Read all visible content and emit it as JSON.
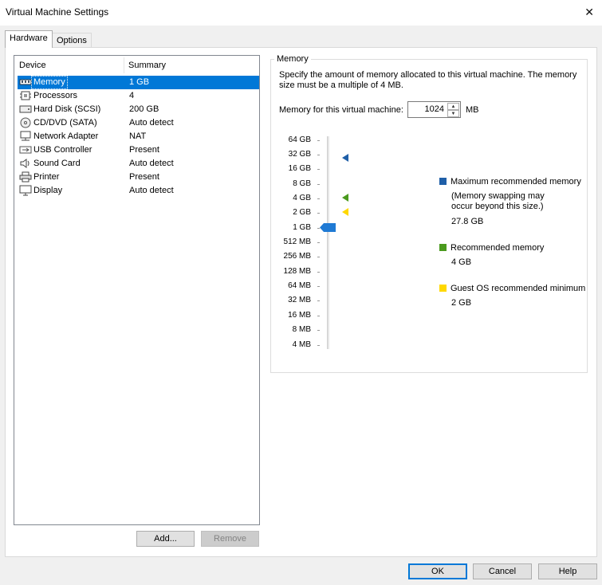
{
  "window": {
    "title": "Virtual Machine Settings",
    "close_glyph": "✕"
  },
  "tabs": [
    {
      "label": "Hardware"
    },
    {
      "label": "Options"
    }
  ],
  "device_list": {
    "headers": {
      "device": "Device",
      "summary": "Summary"
    },
    "rows": [
      {
        "device": "Memory",
        "summary": "1 GB",
        "icon": "memory-icon",
        "selected": true
      },
      {
        "device": "Processors",
        "summary": "4",
        "icon": "processor-icon"
      },
      {
        "device": "Hard Disk (SCSI)",
        "summary": "200 GB",
        "icon": "hard-disk-icon"
      },
      {
        "device": "CD/DVD (SATA)",
        "summary": "Auto detect",
        "icon": "cd-dvd-icon"
      },
      {
        "device": "Network Adapter",
        "summary": "NAT",
        "icon": "network-adapter-icon"
      },
      {
        "device": "USB Controller",
        "summary": "Present",
        "icon": "usb-icon"
      },
      {
        "device": "Sound Card",
        "summary": "Auto detect",
        "icon": "speaker-icon"
      },
      {
        "device": "Printer",
        "summary": "Present",
        "icon": "printer-icon"
      },
      {
        "device": "Display",
        "summary": "Auto detect",
        "icon": "monitor-icon"
      }
    ],
    "add_label": "Add...",
    "remove_label": "Remove"
  },
  "memory": {
    "group_title": "Memory",
    "description": "Specify the amount of memory allocated to this virtual machine. The memory size must be a multiple of 4 MB.",
    "field_label": "Memory for this virtual machine:",
    "value": "1024",
    "unit": "MB",
    "scale": [
      "64 GB",
      "32 GB",
      "16 GB",
      "8 GB",
      "4 GB",
      "2 GB",
      "1 GB",
      "512 MB",
      "256 MB",
      "128 MB",
      "64 MB",
      "32 MB",
      "16 MB",
      "8 MB",
      "4 MB"
    ],
    "slider_value": "1 GB",
    "markers": [
      {
        "at": "32 GB",
        "color": "#1f5fa8"
      },
      {
        "at": "4 GB",
        "color": "#4a9a1e"
      },
      {
        "at": "2 GB",
        "color": "#ffd800"
      }
    ],
    "legend": {
      "max": {
        "label": "Maximum recommended memory",
        "note": "(Memory swapping may occur beyond this size.)",
        "note_line1": "(Memory swapping may",
        "note_line2": "occur beyond this size.)",
        "value": "27.8 GB",
        "color": "#1f5fa8"
      },
      "rec": {
        "label": "Recommended memory",
        "value": "4 GB",
        "color": "#4a9a1e"
      },
      "min": {
        "label": "Guest OS recommended minimum",
        "value": "2 GB",
        "color": "#ffd800"
      }
    }
  },
  "footer": {
    "ok": "OK",
    "cancel": "Cancel",
    "help": "Help"
  },
  "colors": {
    "selection": "#0078d7",
    "slider_thumb": "#1f7ad4"
  }
}
